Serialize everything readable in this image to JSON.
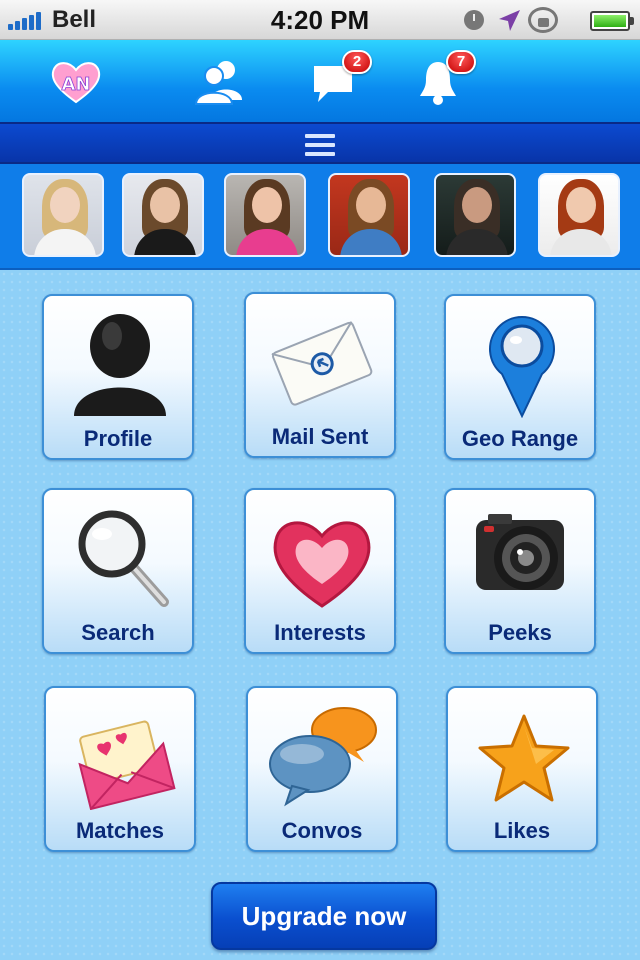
{
  "status_bar": {
    "carrier": "Bell",
    "time": "4:20 PM"
  },
  "top_nav": {
    "items": [
      {
        "name": "app-logo",
        "icon": "heart-logo-icon"
      },
      {
        "name": "friends",
        "icon": "people-icon"
      },
      {
        "name": "messages",
        "icon": "chat-bubble-icon",
        "badge": "2"
      },
      {
        "name": "notifications",
        "icon": "bell-icon",
        "badge": "7"
      }
    ]
  },
  "menu": {
    "icon": "hamburger-menu-icon"
  },
  "avatars": [
    {
      "name": "avatar-1"
    },
    {
      "name": "avatar-2"
    },
    {
      "name": "avatar-3"
    },
    {
      "name": "avatar-4"
    },
    {
      "name": "avatar-5"
    },
    {
      "name": "avatar-6"
    }
  ],
  "tiles": {
    "profile": {
      "label": "Profile",
      "icon": "user-silhouette-icon"
    },
    "mail_sent": {
      "label": "Mail Sent",
      "icon": "envelope-icon"
    },
    "geo_range": {
      "label": "Geo Range",
      "icon": "map-pin-icon"
    },
    "search": {
      "label": "Search",
      "icon": "magnifier-icon"
    },
    "interests": {
      "label": "Interests",
      "icon": "heart-icon"
    },
    "peeks": {
      "label": "Peeks",
      "icon": "camera-icon"
    },
    "matches": {
      "label": "Matches",
      "icon": "love-letter-icon"
    },
    "convos": {
      "label": "Convos",
      "icon": "speech-bubbles-icon"
    },
    "likes": {
      "label": "Likes",
      "icon": "star-icon"
    }
  },
  "upgrade_button": {
    "label": "Upgrade now"
  },
  "colors": {
    "nav_blue": "#0a8bf0",
    "menu_bar": "#0834a8",
    "tile_text": "#0a2a78",
    "background": "#8fd0f7",
    "badge_red": "#c40000"
  }
}
